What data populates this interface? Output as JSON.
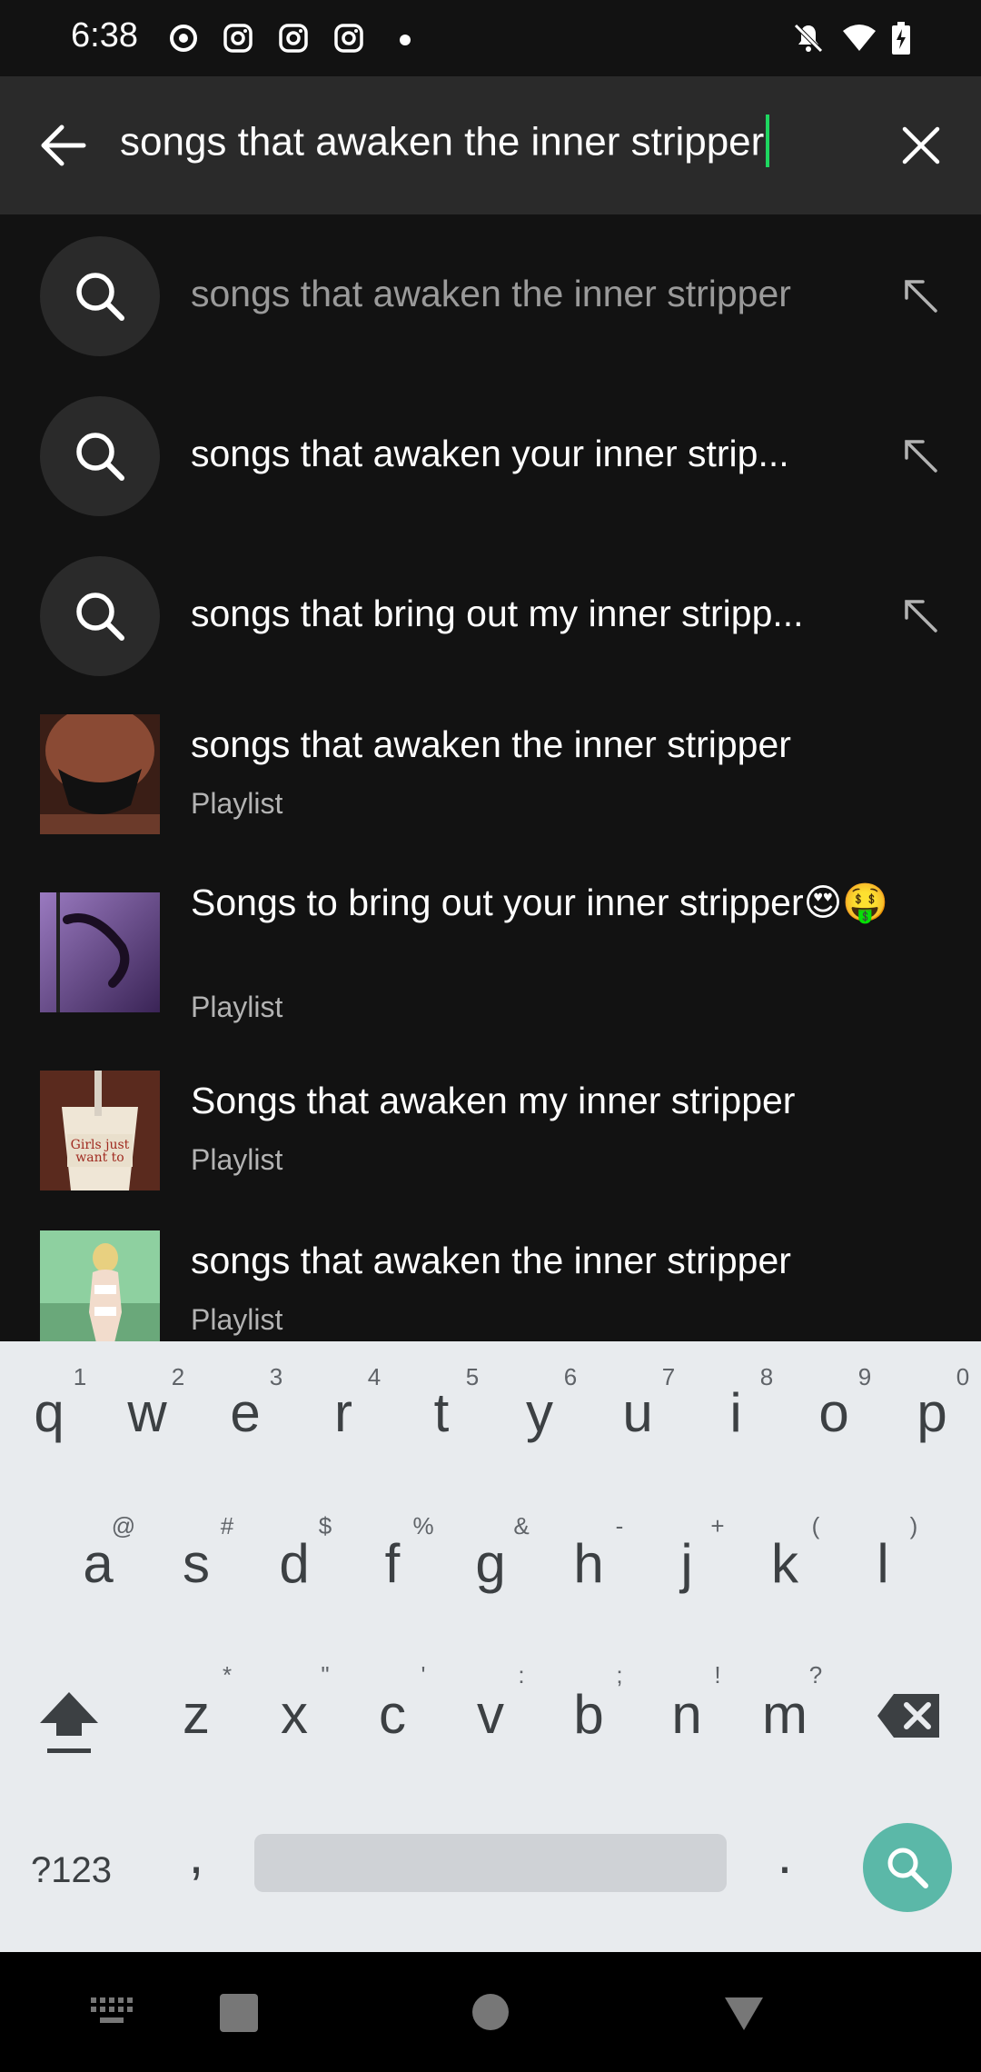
{
  "status_bar": {
    "time": "6:38",
    "left_icons": [
      "record-icon",
      "instagram-icon",
      "instagram-icon",
      "instagram-icon",
      "dot-icon"
    ],
    "right_icons": [
      "notifications-off-icon",
      "wifi-icon",
      "battery-charging-icon"
    ]
  },
  "search": {
    "query": "songs that awaken the inner stripper",
    "accent_color": "#1ed760"
  },
  "suggestions": [
    {
      "text": "songs that awaken the inner stripper",
      "dimmed": true
    },
    {
      "text": "songs that awaken your inner strip...",
      "dimmed": false
    },
    {
      "text": "songs that bring out my inner stripp...",
      "dimmed": false
    }
  ],
  "playlists": [
    {
      "title": "songs that awaken the inner stripper",
      "subtitle": "Playlist"
    },
    {
      "title": "Songs to bring out your inner stripper😍🤑",
      "subtitle": "Playlist"
    },
    {
      "title": "Songs that awaken my inner stripper",
      "subtitle": "Playlist"
    },
    {
      "title": "songs that awaken the inner stripper",
      "subtitle": "Playlist"
    }
  ],
  "keyboard": {
    "row1": [
      "q",
      "w",
      "e",
      "r",
      "t",
      "y",
      "u",
      "i",
      "o",
      "p"
    ],
    "row1_hints": [
      "1",
      "2",
      "3",
      "4",
      "5",
      "6",
      "7",
      "8",
      "9",
      "0"
    ],
    "row2": [
      "a",
      "s",
      "d",
      "f",
      "g",
      "h",
      "j",
      "k",
      "l"
    ],
    "row2_hints": [
      "@",
      "#",
      "$",
      "%",
      "&",
      "-",
      "+",
      "(",
      ")"
    ],
    "row3": [
      "z",
      "x",
      "c",
      "v",
      "b",
      "n",
      "m"
    ],
    "row3_hints": [
      "*",
      "\"",
      "'",
      ":",
      ";",
      "!",
      "?"
    ],
    "symbols_label": "?123",
    "comma": ",",
    "period": ".",
    "enter_color": "#5bb8a8"
  }
}
